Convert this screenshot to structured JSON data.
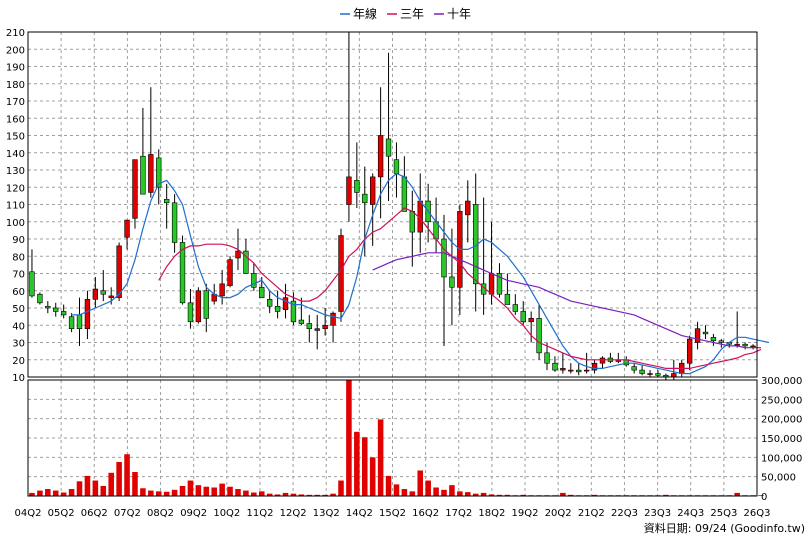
{
  "legend": [
    {
      "label": "年線",
      "color": "#1f6fd0"
    },
    {
      "label": "三年",
      "color": "#d0105a"
    },
    {
      "label": "十年",
      "color": "#7a1fc0"
    }
  ],
  "footer": "資料日期: 09/24  (Goodinfo.tw)",
  "colors": {
    "up": "#e00000",
    "down": "#28c828",
    "volume": "#e00000"
  },
  "chart_data": {
    "type": "candlestick",
    "price_axis": {
      "min": 10,
      "max": 210,
      "ticks": [
        10,
        20,
        30,
        40,
        50,
        60,
        70,
        80,
        90,
        100,
        110,
        120,
        130,
        140,
        150,
        160,
        170,
        180,
        190,
        200,
        210
      ]
    },
    "volume_axis": {
      "min": 0,
      "max": 300000,
      "ticks": [
        0,
        50000,
        100000,
        150000,
        200000,
        250000,
        300000
      ],
      "tick_labels": [
        "0",
        "50,000",
        "100,000",
        "150,000",
        "200,000",
        "250,000",
        "300,000"
      ]
    },
    "x_tick_labels": [
      "04Q2",
      "05Q2",
      "06Q2",
      "07Q2",
      "08Q2",
      "09Q2",
      "10Q2",
      "11Q2",
      "12Q2",
      "13Q2",
      "14Q2",
      "15Q2",
      "16Q2",
      "17Q2",
      "18Q2",
      "19Q2",
      "20Q2",
      "21Q2",
      "22Q3",
      "23Q3",
      "24Q3",
      "25Q3",
      "26Q3"
    ],
    "candles": [
      [
        71,
        84,
        56,
        57
      ],
      [
        58,
        59,
        52,
        53
      ],
      [
        51,
        54,
        47,
        50
      ],
      [
        50,
        53,
        45,
        48
      ],
      [
        48,
        52,
        44,
        46
      ],
      [
        45,
        47,
        36,
        38
      ],
      [
        46,
        56,
        28,
        38
      ],
      [
        38,
        60,
        32,
        55
      ],
      [
        55,
        68,
        50,
        61
      ],
      [
        60,
        72,
        54,
        58
      ],
      [
        56,
        62,
        52,
        57
      ],
      [
        56,
        88,
        54,
        86
      ],
      [
        91,
        101,
        84,
        101
      ],
      [
        102,
        124,
        96,
        136
      ],
      [
        138,
        166,
        132,
        116
      ],
      [
        117,
        178,
        114,
        139
      ],
      [
        137,
        142,
        110,
        120
      ],
      [
        113,
        122,
        96,
        111
      ],
      [
        111,
        116,
        82,
        88
      ],
      [
        88,
        92,
        52,
        53
      ],
      [
        53,
        61,
        38,
        42
      ],
      [
        42,
        62,
        41,
        60
      ],
      [
        60,
        64,
        36,
        44
      ],
      [
        54,
        64,
        52,
        58
      ],
      [
        57,
        72,
        52,
        64
      ],
      [
        63,
        80,
        62,
        78
      ],
      [
        79,
        96,
        72,
        83
      ],
      [
        83,
        90,
        72,
        70
      ],
      [
        70,
        76,
        60,
        62
      ],
      [
        62,
        68,
        56,
        56
      ],
      [
        55,
        60,
        47,
        51
      ],
      [
        51,
        60,
        44,
        48
      ],
      [
        49,
        64,
        44,
        56
      ],
      [
        54,
        59,
        40,
        42
      ],
      [
        43,
        56,
        40,
        41
      ],
      [
        41,
        46,
        30,
        38
      ],
      [
        37,
        46,
        26,
        38
      ],
      [
        38,
        50,
        34,
        40
      ],
      [
        40,
        48,
        30,
        47
      ],
      [
        48,
        96,
        42,
        92
      ],
      [
        110,
        210,
        100,
        126
      ],
      [
        124,
        146,
        108,
        117
      ],
      [
        116,
        132,
        80,
        111
      ],
      [
        110,
        128,
        86,
        126
      ],
      [
        126,
        178,
        102,
        150
      ],
      [
        148,
        198,
        112,
        138
      ],
      [
        136,
        146,
        114,
        128
      ],
      [
        126,
        138,
        106,
        106
      ],
      [
        106,
        118,
        74,
        94
      ],
      [
        94,
        128,
        82,
        112
      ],
      [
        112,
        122,
        88,
        100
      ],
      [
        100,
        114,
        82,
        90
      ],
      [
        90,
        104,
        28,
        68
      ],
      [
        68,
        96,
        40,
        62
      ],
      [
        62,
        110,
        46,
        106
      ],
      [
        104,
        124,
        88,
        112
      ],
      [
        110,
        128,
        48,
        64
      ],
      [
        64,
        114,
        46,
        58
      ],
      [
        58,
        100,
        52,
        70
      ],
      [
        70,
        76,
        56,
        58
      ],
      [
        58,
        70,
        52,
        52
      ],
      [
        52,
        58,
        46,
        48
      ],
      [
        48,
        54,
        40,
        42
      ],
      [
        42,
        48,
        30,
        44
      ],
      [
        44,
        52,
        20,
        24
      ],
      [
        24,
        30,
        14,
        18
      ],
      [
        18,
        22,
        13,
        14
      ],
      [
        14,
        24,
        12,
        15
      ],
      [
        14,
        18,
        12,
        14
      ],
      [
        14,
        18,
        11,
        13
      ],
      [
        14,
        24,
        12,
        14
      ],
      [
        14,
        20,
        12,
        18
      ],
      [
        18,
        22,
        15,
        21
      ],
      [
        21,
        24,
        18,
        19
      ],
      [
        19,
        24,
        18,
        20
      ],
      [
        20,
        22,
        16,
        17
      ],
      [
        16,
        18,
        12,
        14
      ],
      [
        14,
        17,
        11,
        12
      ],
      [
        12,
        14,
        10,
        12
      ],
      [
        12,
        14,
        10,
        11
      ],
      [
        11,
        12,
        8,
        10
      ],
      [
        10,
        20,
        8,
        12
      ],
      [
        12,
        20,
        10,
        18
      ],
      [
        18,
        34,
        14,
        32
      ],
      [
        30,
        42,
        26,
        38
      ],
      [
        36,
        40,
        32,
        35
      ],
      [
        33,
        35,
        28,
        31
      ],
      [
        31,
        32,
        27,
        30
      ],
      [
        30,
        30,
        27,
        29
      ],
      [
        29,
        48,
        27,
        29
      ],
      [
        29,
        30,
        26,
        28
      ],
      [
        28,
        29,
        26,
        28
      ]
    ],
    "volumes": [
      8000,
      14000,
      18000,
      14000,
      9000,
      18000,
      38000,
      52000,
      40000,
      26000,
      60000,
      88000,
      108000,
      62000,
      20000,
      14000,
      12000,
      11000,
      16000,
      26000,
      40000,
      28000,
      24000,
      22000,
      32000,
      24000,
      18000,
      14000,
      9000,
      12000,
      6000,
      4000,
      8000,
      6000,
      4000,
      3000,
      3000,
      3000,
      6000,
      40000,
      300000,
      166000,
      152000,
      100000,
      198000,
      52000,
      30000,
      18000,
      12000,
      66000,
      40000,
      22000,
      16000,
      28000,
      12000,
      10000,
      6000,
      8000,
      4000,
      3000,
      3000,
      2000,
      3000,
      2000,
      2000,
      2000,
      2000,
      8000,
      3000,
      2000,
      2000,
      3000,
      2000,
      2000,
      2000,
      2000,
      2000,
      2000,
      2000,
      2000,
      3000,
      2000,
      2000,
      2000,
      2000,
      2000,
      2000,
      2000,
      2000,
      8000,
      2000,
      2000,
      2000
    ],
    "series": [
      {
        "name": "年線",
        "values": [
          null,
          null,
          null,
          null,
          null,
          46,
          46,
          48,
          50,
          52,
          54,
          58,
          64,
          78,
          96,
          112,
          122,
          124,
          118,
          110,
          92,
          74,
          62,
          58,
          56,
          56,
          58,
          62,
          64,
          66,
          60,
          56,
          54,
          52,
          52,
          50,
          48,
          46,
          45,
          44,
          52,
          68,
          90,
          104,
          116,
          124,
          128,
          126,
          120,
          112,
          106,
          100,
          94,
          88,
          84,
          84,
          86,
          90,
          88,
          84,
          80,
          74,
          68,
          60,
          52,
          44,
          36,
          28,
          22,
          18,
          16,
          15,
          15,
          16,
          17,
          18,
          18,
          17,
          16,
          15,
          14,
          13,
          12,
          12,
          14,
          16,
          20,
          26,
          30,
          33,
          33,
          32,
          31,
          30
        ]
      },
      {
        "name": "三年",
        "values": [
          null,
          null,
          null,
          null,
          null,
          null,
          null,
          null,
          null,
          null,
          null,
          null,
          null,
          null,
          null,
          null,
          66,
          74,
          80,
          84,
          86,
          86,
          87,
          87,
          87,
          86,
          84,
          80,
          76,
          70,
          66,
          62,
          58,
          56,
          54,
          54,
          56,
          60,
          66,
          72,
          80,
          84,
          90,
          94,
          96,
          100,
          104,
          108,
          106,
          102,
          96,
          90,
          84,
          80,
          76,
          70,
          66,
          62,
          58,
          54,
          50,
          44,
          40,
          34,
          30,
          28,
          26,
          24,
          22,
          21,
          20,
          20,
          20,
          20,
          20,
          20,
          19,
          18,
          17,
          16,
          15,
          15,
          15,
          15,
          16,
          17,
          18,
          19,
          20,
          21,
          23,
          24,
          26
        ]
      },
      {
        "name": "十年",
        "values": [
          null,
          null,
          null,
          null,
          null,
          null,
          null,
          null,
          null,
          null,
          null,
          null,
          null,
          null,
          null,
          null,
          null,
          null,
          null,
          null,
          null,
          null,
          null,
          null,
          null,
          null,
          null,
          null,
          null,
          null,
          null,
          null,
          null,
          null,
          null,
          null,
          null,
          null,
          null,
          null,
          null,
          null,
          null,
          72,
          74,
          76,
          78,
          79,
          80,
          81,
          82,
          82,
          82,
          80,
          78,
          76,
          74,
          72,
          70,
          68,
          66,
          65,
          64,
          63,
          62,
          60,
          58,
          56,
          54,
          53,
          52,
          51,
          50,
          49,
          48,
          47,
          46,
          44,
          42,
          40,
          38,
          36,
          34,
          33,
          32,
          31,
          30,
          29,
          28,
          28,
          27,
          27,
          27
        ]
      }
    ]
  }
}
